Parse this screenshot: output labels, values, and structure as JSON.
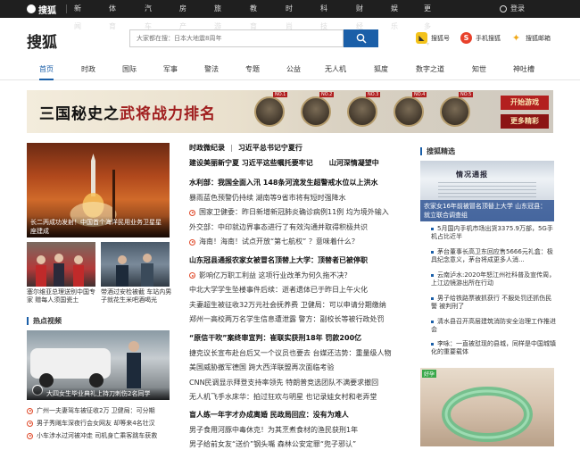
{
  "topbar": {
    "logo": "搜狐",
    "nav": [
      "新闻",
      "体育",
      "汽车",
      "房产",
      "旅游",
      "教育",
      "时尚",
      "科技",
      "财经",
      "娱乐",
      "更多"
    ],
    "login": "登录"
  },
  "header": {
    "brand_sohu": "搜狐",
    "brand_news": "新闻",
    "search_placeholder": "大家都在搜：日本大地震8周年",
    "links": [
      "搜狐号",
      "手机搜狐",
      "搜狐邮箱"
    ]
  },
  "channels": [
    "首页",
    "时政",
    "国际",
    "军事",
    "警法",
    "专题",
    "公益",
    "无人机",
    "狐度",
    "数字之道",
    "知世",
    "神吐槽"
  ],
  "banner": {
    "title_a": "三国秘史之",
    "title_b": "武将战力排名",
    "ranks": [
      "NO.1",
      "NO.2",
      "NO.3",
      "NO.4",
      "NO.5"
    ],
    "btn_start": "开始游戏",
    "btn_more": "更多精彩"
  },
  "left": {
    "main_caption": "长二丙成功发射！中国首个海洋民用业务卫星星座建成",
    "thumb1_caption": "塞尔维亚总理送别中国专家 赠每人须国瓷土",
    "thumb2_caption": "带酒过安检被截 车站内男子就花生米吧酒喝光",
    "hot_title": "热点视频",
    "video_caption": "大四女生毕业典礼上持刀刺伤2名同学",
    "hot_items": [
      "广州一夫妻驾车被征收2万 卫健局：可分期",
      "男子秀飚车深夜行会女网友 却等来4名壮汉",
      "小车涉水过河被冲走 司机身亡乘客跳车获救"
    ]
  },
  "middle": {
    "top_line_a": "时政微纪录",
    "top_line_b": "习近平总书记宁夏行",
    "top_line2_a": "建设美丽新宁夏 习近平这些嘱托要牢记",
    "top_line2_b": "山河深情凝望中",
    "group1": [
      {
        "text": "水利部：我国全面入汛 148条河流发生超警戒水位以上洪水",
        "bold": true,
        "dot": false
      },
      {
        "text": "暴雨蓝色预警仍持续 湖南等9省市将有短时强降水",
        "bold": false,
        "dot": false
      },
      {
        "text": "国家卫健委：昨日新增新冠肺炎确诊病例11例 均为境外输入",
        "bold": false,
        "dot": true
      },
      {
        "text": "外交部：中印就边界事态进行了有效沟通并取得积极共识",
        "bold": false,
        "dot": false
      },
      {
        "text": "海南！海南！试点开放“第七航权” ？意味着什么？",
        "bold": false,
        "dot": true
      }
    ],
    "group2": [
      {
        "text": "山东冠县通报农家女被冒名顶替上大学：顶替者已被停职",
        "bold": true,
        "dot": false
      },
      {
        "text": "影响亿万职工利益 这项行业改革为何久拖不决？",
        "bold": false,
        "dot": true
      },
      {
        "text": "中北大学学生坠楼事件后续：逝者遗体已于昨日上午火化",
        "bold": false,
        "dot": false
      },
      {
        "text": "夫妻超生被征收32万元社会抚养费 卫健局：可以申请分期缴纳",
        "bold": false,
        "dot": false
      },
      {
        "text": "郑州一高校两万名学生信息遭泄露 警方：副校长等被行政处罚",
        "bold": false,
        "dot": false
      }
    ],
    "group3": [
      {
        "text": "“原信干吹”案终审宣判：崔联实获刑18年 罚款200亿",
        "bold": true,
        "dot": false
      },
      {
        "text": "捷克议长宣布赴台后又一个议员也要去 台媒还洁势：重量级人物",
        "bold": false,
        "dot": false
      },
      {
        "text": "美国威胁撤军德国 跨大西洋联盟再次面临考验",
        "bold": false,
        "dot": false
      },
      {
        "text": "CNN民调显示拜登支持率领先 特朗普竞选团队不满要求撤回",
        "bold": false,
        "dot": false
      },
      {
        "text": "无人机飞手水床华：拍过狂欢与明星 也记录娃女村和老弄堂",
        "bold": false,
        "dot": false
      }
    ],
    "group4": [
      {
        "text": "盲人练一年字才办成离婚 民政局回应：没有为难人",
        "bold": true,
        "dot": false
      },
      {
        "text": "男子食用河豚中毒休克！为其烹煮食材的渔民获刑1年",
        "bold": false,
        "dot": false
      },
      {
        "text": "男子给前女友“送价”钢头嘴 森林公安定罪“兜子邪认”",
        "bold": false,
        "dot": false
      }
    ]
  },
  "right": {
    "title": "搜狐精选",
    "feature_caption": "农家女16年前被冒名顶替上大学 山东冠县：就立联合调查组",
    "feature_tag": "情况通报",
    "items": [
      "5月国内手机市场出货3375.9万部，5G手机占比近半",
      "茅台董事长高卫东回应售5666元礼盒：极具纪念意义，茅台将成更多人消...",
      "云南泸水:2020年怒江州社科普及宣传周，上江边镜游出所在行动",
      "男子给铁路票被抓获行 不服处罚还抓伤民警 被判刑了",
      "清水县召开高层建筑消防安全治理工作推进会",
      "李咏：一直被怼现的县城，同样是中国城镇化的重要载体"
    ],
    "bottom_tag": "好孕"
  },
  "colors": {
    "accent": "#1b5fa8",
    "topbar": "#1f1f1f",
    "red": "#e04a2a"
  }
}
